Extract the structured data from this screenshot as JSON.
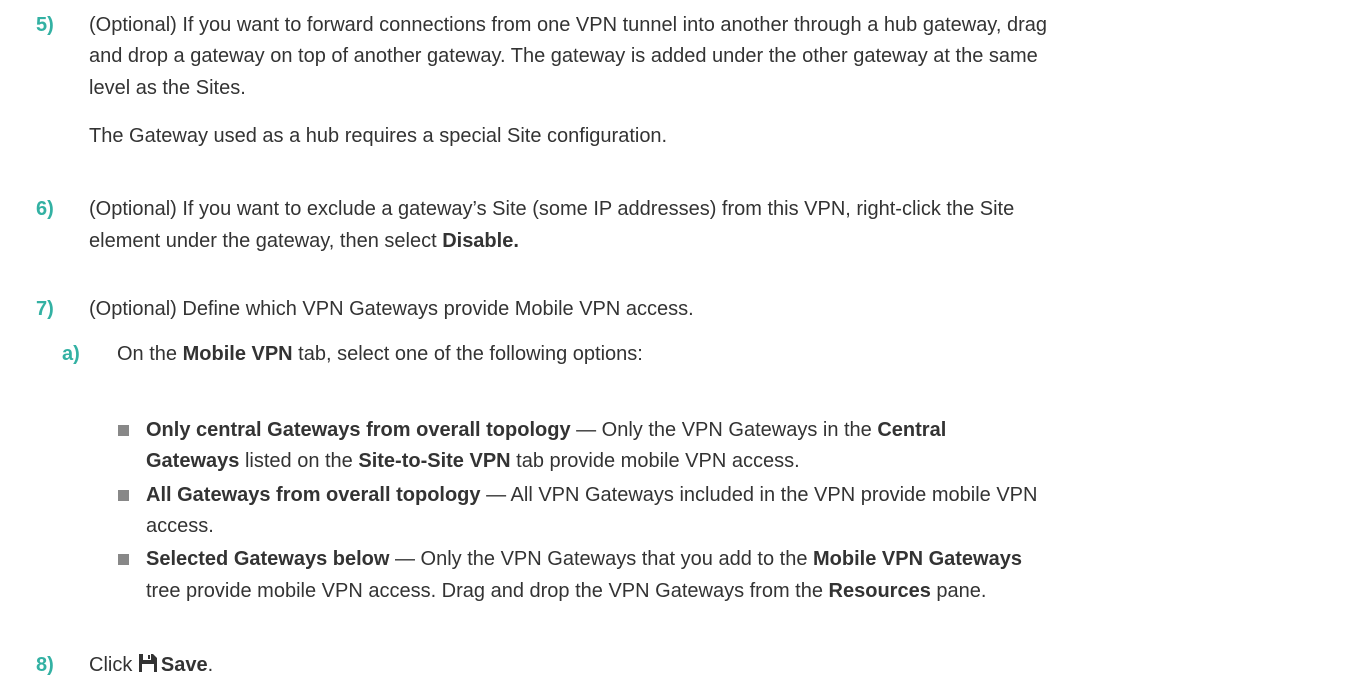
{
  "steps": [
    {
      "number": "5)",
      "lines": [
        "(Optional) If you want to forward connections from one VPN tunnel into another through a hub gateway, drag",
        "and drop a gateway on top of another gateway. The gateway is added under the other gateway at the same",
        "level as the Sites."
      ],
      "note": "The Gateway used as a hub requires a special Site configuration."
    },
    {
      "number": "6)",
      "line1": "(Optional) If you want to exclude a gateway’s Site (some IP addresses) from this VPN, right-click the Site",
      "line2_pre": "element under the gateway, then select ",
      "line2_bold": "Disable."
    },
    {
      "number": "7)",
      "line1": "(Optional) Define which VPN Gateways provide Mobile VPN access.",
      "substep": {
        "letter": "a)",
        "pre": "On the ",
        "bold": "Mobile VPN",
        "post": " tab, select one of the following options:"
      },
      "options": [
        {
          "l1_bold": "Only central Gateways from overall topology",
          "l1_mid": " — Only the VPN Gateways in the ",
          "l1_bold2": "Central",
          "l2_bold": "Gateways",
          "l2_mid": " listed on the ",
          "l2_bold2": "Site-to-Site VPN",
          "l2_post": " tab provide mobile VPN access."
        },
        {
          "l1_bold": "All Gateways from overall topology",
          "l1_post": " — All VPN Gateways included in the VPN provide mobile VPN",
          "l2": "access."
        },
        {
          "l1_bold": "Selected Gateways below",
          "l1_mid": " — Only the VPN Gateways that you add to the ",
          "l1_bold2": "Mobile VPN Gateways",
          "l2_pre": "tree provide mobile VPN access. Drag and drop the VPN Gateways from the ",
          "l2_bold": "Resources",
          "l2_post": " pane."
        }
      ]
    },
    {
      "number": "8)",
      "pre": "Click ",
      "icon": "save-icon",
      "bold": "Save",
      "post": "."
    }
  ],
  "colors": {
    "accent": "#33b1a3",
    "text": "#333333",
    "bullet": "#888888"
  }
}
